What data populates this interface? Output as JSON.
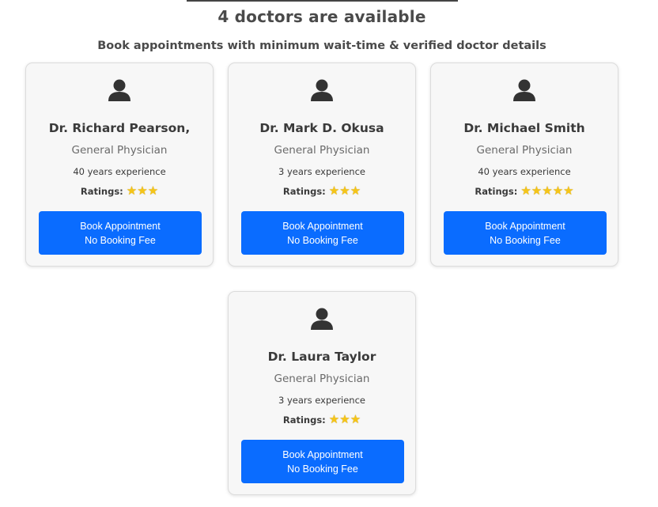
{
  "header": {
    "title": "4 doctors are available",
    "subtitle": "Book appointments with minimum wait-time & verified doctor details"
  },
  "ratings_label": "Ratings:",
  "doctors": [
    {
      "name": "Dr. Richard Pearson,",
      "specialty": "General Physician",
      "experience": "40 years experience",
      "rating_stars": 3,
      "button_line1": "Book Appointment",
      "button_line2": "No Booking Fee"
    },
    {
      "name": "Dr. Mark D. Okusa",
      "specialty": "General Physician",
      "experience": "3 years experience",
      "rating_stars": 3,
      "button_line1": "Book Appointment",
      "button_line2": "No Booking Fee"
    },
    {
      "name": "Dr. Michael Smith",
      "specialty": "General Physician",
      "experience": "40 years experience",
      "rating_stars": 5,
      "button_line1": "Book Appointment",
      "button_line2": "No Booking Fee"
    },
    {
      "name": "Dr. Laura Taylor",
      "specialty": "General Physician",
      "experience": "3 years experience",
      "rating_stars": 3,
      "button_line1": "Book Appointment",
      "button_line2": "No Booking Fee"
    }
  ],
  "colors": {
    "button": "#0a6cff",
    "star": "#f5c518",
    "avatar": "#333333"
  },
  "icons": {
    "avatar": "user-icon",
    "star": "star-icon"
  }
}
